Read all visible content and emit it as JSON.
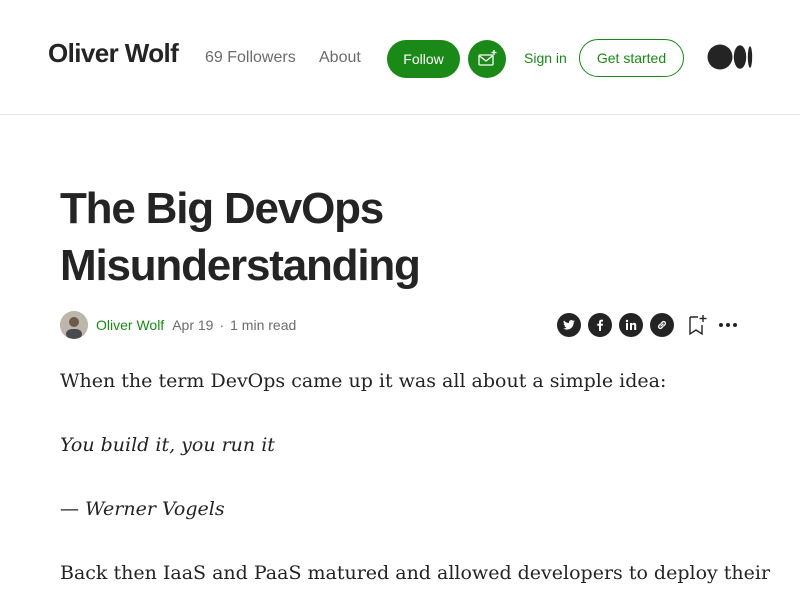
{
  "header": {
    "brand": "Oliver Wolf",
    "followers": "69 Followers",
    "about": "About",
    "follow_label": "Follow",
    "signin_label": "Sign in",
    "getstarted_label": "Get started",
    "accent_color": "#1a8917",
    "subscribe_icon": "mail-plus-icon",
    "logo_icon": "medium-logo-icon"
  },
  "article": {
    "title": "The Big DevOps Misunderstanding",
    "author": "Oliver Wolf",
    "date": "Apr 19",
    "separator": "·",
    "read_time": "1 min read",
    "share_icons": [
      "twitter-icon",
      "facebook-icon",
      "linkedin-icon",
      "link-icon"
    ],
    "paragraph1": "When the term DevOps came up it was all about a simple idea:",
    "quote": "You build it, you run it",
    "attribution_dash": "— ",
    "attribution_name": "Werner Vogels",
    "paragraph2": "Back then IaaS and PaaS matured and allowed developers to deploy their"
  }
}
